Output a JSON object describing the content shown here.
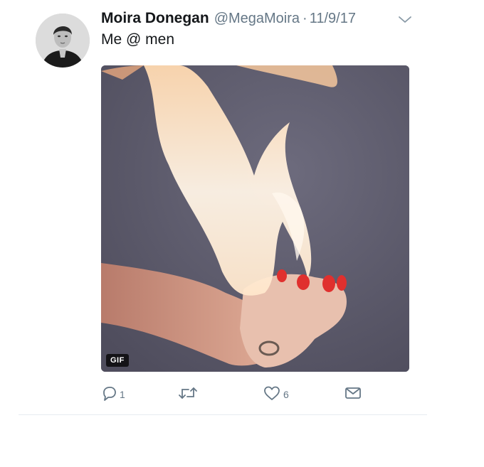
{
  "tweet": {
    "author_name": "Moira Donegan",
    "handle": "@MegaMoira",
    "separator": "·",
    "date": "11/9/17",
    "text": "Me @ men",
    "media": {
      "badge": "GIF",
      "description_icon": "gif-image"
    },
    "actions": {
      "reply_count": "1",
      "retweet_count": "",
      "like_count": "6"
    }
  },
  "colors": {
    "text": "#14171a",
    "secondary": "#657786",
    "divider": "#e6ecf0",
    "media_background": "#5d5b6d"
  },
  "icons": [
    "reply-icon",
    "retweet-icon",
    "like-icon",
    "direct-message-icon",
    "chevron-down-icon"
  ]
}
